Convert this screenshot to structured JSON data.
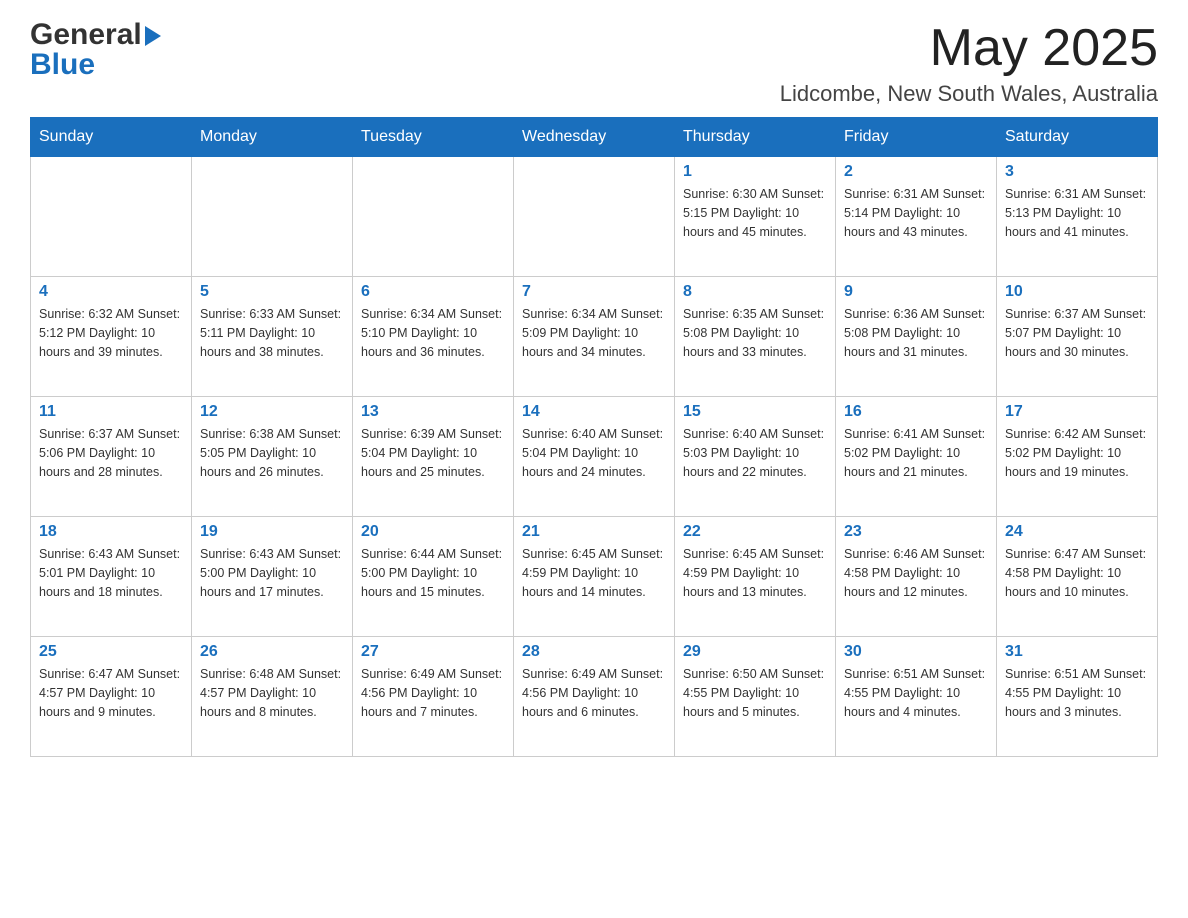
{
  "header": {
    "logo_general": "General",
    "logo_blue": "Blue",
    "month_title": "May 2025",
    "location": "Lidcombe, New South Wales, Australia"
  },
  "calendar": {
    "days_of_week": [
      "Sunday",
      "Monday",
      "Tuesday",
      "Wednesday",
      "Thursday",
      "Friday",
      "Saturday"
    ],
    "weeks": [
      [
        {
          "day": "",
          "info": ""
        },
        {
          "day": "",
          "info": ""
        },
        {
          "day": "",
          "info": ""
        },
        {
          "day": "",
          "info": ""
        },
        {
          "day": "1",
          "info": "Sunrise: 6:30 AM\nSunset: 5:15 PM\nDaylight: 10 hours\nand 45 minutes."
        },
        {
          "day": "2",
          "info": "Sunrise: 6:31 AM\nSunset: 5:14 PM\nDaylight: 10 hours\nand 43 minutes."
        },
        {
          "day": "3",
          "info": "Sunrise: 6:31 AM\nSunset: 5:13 PM\nDaylight: 10 hours\nand 41 minutes."
        }
      ],
      [
        {
          "day": "4",
          "info": "Sunrise: 6:32 AM\nSunset: 5:12 PM\nDaylight: 10 hours\nand 39 minutes."
        },
        {
          "day": "5",
          "info": "Sunrise: 6:33 AM\nSunset: 5:11 PM\nDaylight: 10 hours\nand 38 minutes."
        },
        {
          "day": "6",
          "info": "Sunrise: 6:34 AM\nSunset: 5:10 PM\nDaylight: 10 hours\nand 36 minutes."
        },
        {
          "day": "7",
          "info": "Sunrise: 6:34 AM\nSunset: 5:09 PM\nDaylight: 10 hours\nand 34 minutes."
        },
        {
          "day": "8",
          "info": "Sunrise: 6:35 AM\nSunset: 5:08 PM\nDaylight: 10 hours\nand 33 minutes."
        },
        {
          "day": "9",
          "info": "Sunrise: 6:36 AM\nSunset: 5:08 PM\nDaylight: 10 hours\nand 31 minutes."
        },
        {
          "day": "10",
          "info": "Sunrise: 6:37 AM\nSunset: 5:07 PM\nDaylight: 10 hours\nand 30 minutes."
        }
      ],
      [
        {
          "day": "11",
          "info": "Sunrise: 6:37 AM\nSunset: 5:06 PM\nDaylight: 10 hours\nand 28 minutes."
        },
        {
          "day": "12",
          "info": "Sunrise: 6:38 AM\nSunset: 5:05 PM\nDaylight: 10 hours\nand 26 minutes."
        },
        {
          "day": "13",
          "info": "Sunrise: 6:39 AM\nSunset: 5:04 PM\nDaylight: 10 hours\nand 25 minutes."
        },
        {
          "day": "14",
          "info": "Sunrise: 6:40 AM\nSunset: 5:04 PM\nDaylight: 10 hours\nand 24 minutes."
        },
        {
          "day": "15",
          "info": "Sunrise: 6:40 AM\nSunset: 5:03 PM\nDaylight: 10 hours\nand 22 minutes."
        },
        {
          "day": "16",
          "info": "Sunrise: 6:41 AM\nSunset: 5:02 PM\nDaylight: 10 hours\nand 21 minutes."
        },
        {
          "day": "17",
          "info": "Sunrise: 6:42 AM\nSunset: 5:02 PM\nDaylight: 10 hours\nand 19 minutes."
        }
      ],
      [
        {
          "day": "18",
          "info": "Sunrise: 6:43 AM\nSunset: 5:01 PM\nDaylight: 10 hours\nand 18 minutes."
        },
        {
          "day": "19",
          "info": "Sunrise: 6:43 AM\nSunset: 5:00 PM\nDaylight: 10 hours\nand 17 minutes."
        },
        {
          "day": "20",
          "info": "Sunrise: 6:44 AM\nSunset: 5:00 PM\nDaylight: 10 hours\nand 15 minutes."
        },
        {
          "day": "21",
          "info": "Sunrise: 6:45 AM\nSunset: 4:59 PM\nDaylight: 10 hours\nand 14 minutes."
        },
        {
          "day": "22",
          "info": "Sunrise: 6:45 AM\nSunset: 4:59 PM\nDaylight: 10 hours\nand 13 minutes."
        },
        {
          "day": "23",
          "info": "Sunrise: 6:46 AM\nSunset: 4:58 PM\nDaylight: 10 hours\nand 12 minutes."
        },
        {
          "day": "24",
          "info": "Sunrise: 6:47 AM\nSunset: 4:58 PM\nDaylight: 10 hours\nand 10 minutes."
        }
      ],
      [
        {
          "day": "25",
          "info": "Sunrise: 6:47 AM\nSunset: 4:57 PM\nDaylight: 10 hours\nand 9 minutes."
        },
        {
          "day": "26",
          "info": "Sunrise: 6:48 AM\nSunset: 4:57 PM\nDaylight: 10 hours\nand 8 minutes."
        },
        {
          "day": "27",
          "info": "Sunrise: 6:49 AM\nSunset: 4:56 PM\nDaylight: 10 hours\nand 7 minutes."
        },
        {
          "day": "28",
          "info": "Sunrise: 6:49 AM\nSunset: 4:56 PM\nDaylight: 10 hours\nand 6 minutes."
        },
        {
          "day": "29",
          "info": "Sunrise: 6:50 AM\nSunset: 4:55 PM\nDaylight: 10 hours\nand 5 minutes."
        },
        {
          "day": "30",
          "info": "Sunrise: 6:51 AM\nSunset: 4:55 PM\nDaylight: 10 hours\nand 4 minutes."
        },
        {
          "day": "31",
          "info": "Sunrise: 6:51 AM\nSunset: 4:55 PM\nDaylight: 10 hours\nand 3 minutes."
        }
      ]
    ]
  }
}
